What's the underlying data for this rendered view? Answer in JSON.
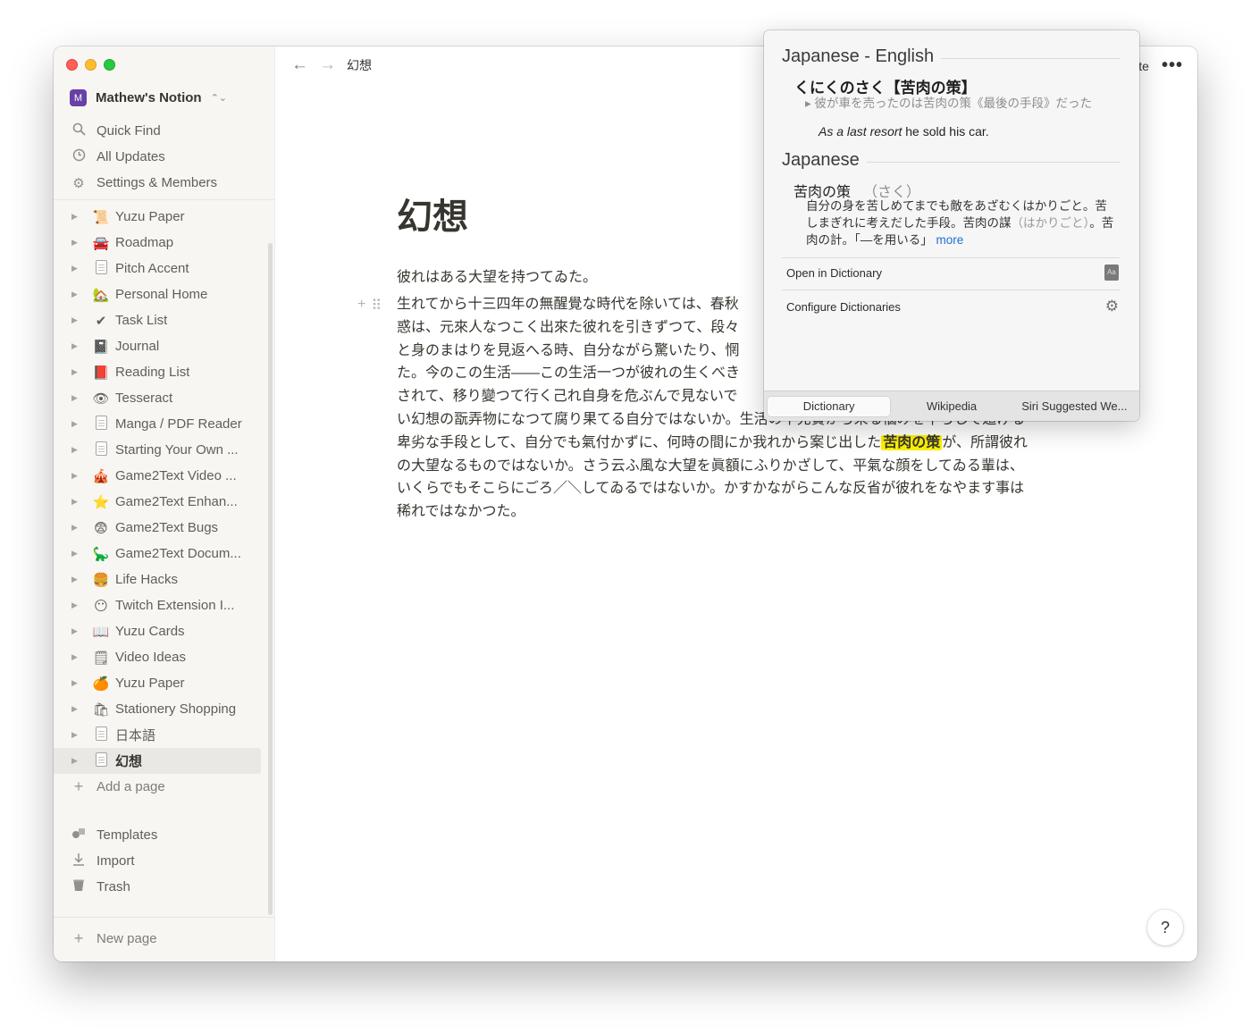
{
  "workspace": {
    "avatar": "M",
    "name": "Mathew's Notion"
  },
  "sidebar_nav": [
    {
      "icon": "search-icon",
      "label": "Quick Find"
    },
    {
      "icon": "clock-icon",
      "label": "All Updates"
    },
    {
      "icon": "gear-icon",
      "label": "Settings & Members"
    }
  ],
  "pages": [
    {
      "emoji": "📜",
      "label": "Yuzu Paper"
    },
    {
      "emoji": "🚘",
      "label": "Roadmap"
    },
    {
      "emoji": "",
      "label": "Pitch Accent"
    },
    {
      "emoji": "🏡",
      "label": "Personal Home"
    },
    {
      "emoji": "✔",
      "label": "Task List"
    },
    {
      "emoji": "📓",
      "label": "Journal"
    },
    {
      "emoji": "📕",
      "label": "Reading List"
    },
    {
      "emoji": "👁",
      "label": "Tesseract"
    },
    {
      "emoji": "",
      "label": "Manga / PDF Reader"
    },
    {
      "emoji": "",
      "label": "Starting Your Own ..."
    },
    {
      "emoji": "🎪",
      "label": "Game2Text Video ..."
    },
    {
      "emoji": "⭐",
      "label": "Game2Text Enhan..."
    },
    {
      "emoji": "😨",
      "label": "Game2Text Bugs"
    },
    {
      "emoji": "🦕",
      "label": "Game2Text Docum..."
    },
    {
      "emoji": "🍔",
      "label": "Life Hacks"
    },
    {
      "emoji": "😶",
      "label": "Twitch Extension I..."
    },
    {
      "emoji": "📖",
      "label": "Yuzu Cards"
    },
    {
      "emoji": "🗒",
      "label": "Video Ideas"
    },
    {
      "emoji": "🍊",
      "label": "Yuzu Paper"
    },
    {
      "emoji": "🛍",
      "label": "Stationery Shopping"
    },
    {
      "emoji": "",
      "label": "日本語"
    },
    {
      "emoji": "",
      "label": "幻想"
    }
  ],
  "add_page": "Add a page",
  "bottom_tools": [
    {
      "icon": "templates-icon",
      "label": "Templates"
    },
    {
      "icon": "import-icon",
      "label": "Import"
    },
    {
      "icon": "trash-icon",
      "label": "Trash"
    }
  ],
  "new_page": "New page",
  "topbar": {
    "breadcrumb": "幻想",
    "right_text": "te",
    "more": "•••"
  },
  "document": {
    "title": "幻想",
    "para1": "彼れはある大望を持つてゐた。",
    "para2_before": "生れてから十三四年の無醒覺な時代を除いては、春秋",
    "para2_line2": "惑は、元來人なつこく出來た彼れを引きずつて、段々",
    "para2_line3": "と身のまはりを見返へる時、自分ながら驚いたり、惘",
    "para2_line4": "た。今のこの生活——この生活一つが彼れの生くべき",
    "para2_line5": "されて、移り變つて行く己れ自身を危ぶんで見ないで",
    "para2_line6": "い幻想の翫弄物になつて腐り果てる自分ではないか。生活の不充實から來る惱みを平らして遁げる",
    "para2_line7a": "卑劣な手段として、自分でも氣付かずに、何時の間にか我れから案じ出した",
    "highlight": "苦肉の策",
    "para2_line7b": "が、所謂彼れ",
    "para2_line8": "の大望なるものではないか。さう云ふ風な大望を眞額にふりかざして、平氣な顔をしてゐる輩は、",
    "para2_line9": "いくらでもそこらにごろ／＼してゐるではないか。かすかながらこんな反省が彼れをなやます事は",
    "para2_line10": "稀れではなかつた。"
  },
  "dictionary": {
    "section1": "Japanese - English",
    "entry": "くにくのさく【苦肉の策】",
    "example_jp": "▸ 彼が車を売ったのは苦肉の策《最後の手段》だった",
    "example_en_italic": "As a last resort",
    "example_en_rest": " he sold his car.",
    "section2": "Japanese",
    "word": "苦肉の策",
    "reading": "（さく）",
    "definition": "自分の身を苦しめてまでも敵をあざむくはかりごと。苦しまぎれに考えだした手段。苦肉の謀",
    "definition_dim": "（はかりごと）",
    "definition_tail": "。苦肉の計。「—を用いる」",
    "more": "more",
    "open_in_dictionary": "Open in Dictionary",
    "configure": "Configure Dictionaries",
    "tabs": [
      "Dictionary",
      "Wikipedia",
      "Siri Suggested We..."
    ],
    "selected_tab": "Dictionary"
  },
  "help": "?"
}
